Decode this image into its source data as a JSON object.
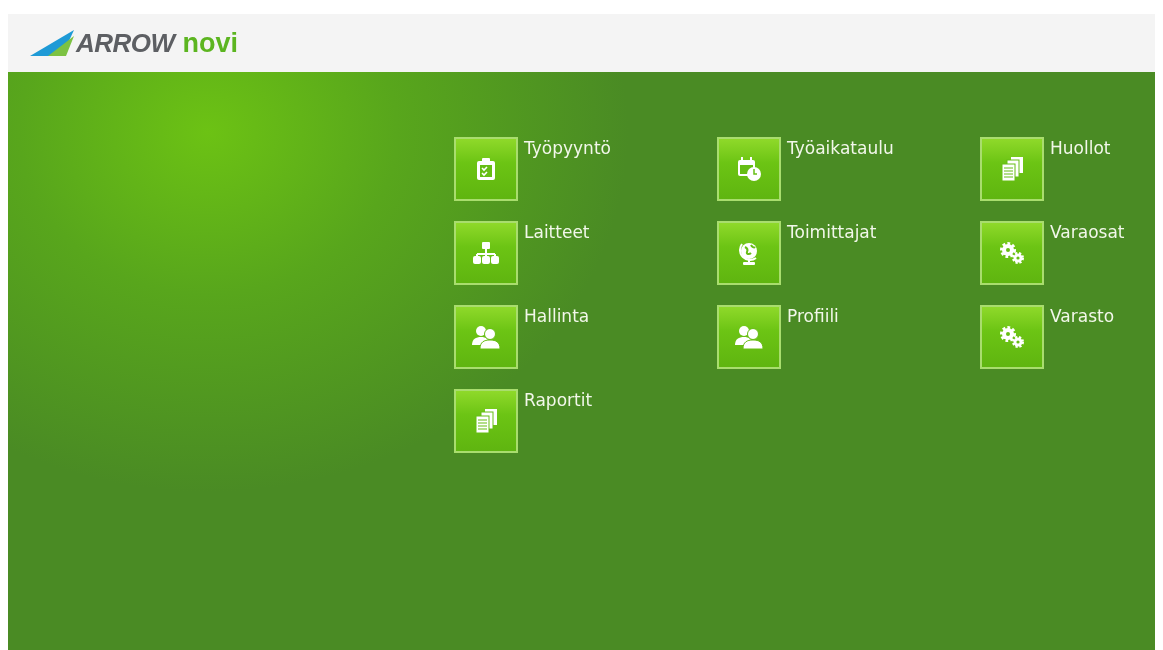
{
  "logo": {
    "brand": "ARROW",
    "product": "novi"
  },
  "tiles": [
    {
      "label": "Työpyyntö",
      "kind": "clipboard"
    },
    {
      "label": "Työaikataulu",
      "kind": "calendar"
    },
    {
      "label": "Huollot",
      "kind": "documents"
    },
    {
      "label": "Laitteet",
      "kind": "hierarchy"
    },
    {
      "label": "Toimittajat",
      "kind": "globe"
    },
    {
      "label": "Varaosat",
      "kind": "gears"
    },
    {
      "label": "Hallinta",
      "kind": "users"
    },
    {
      "label": "Profiili",
      "kind": "users"
    },
    {
      "label": "Varasto",
      "kind": "gears"
    },
    {
      "label": "Raportit",
      "kind": "documents"
    }
  ]
}
